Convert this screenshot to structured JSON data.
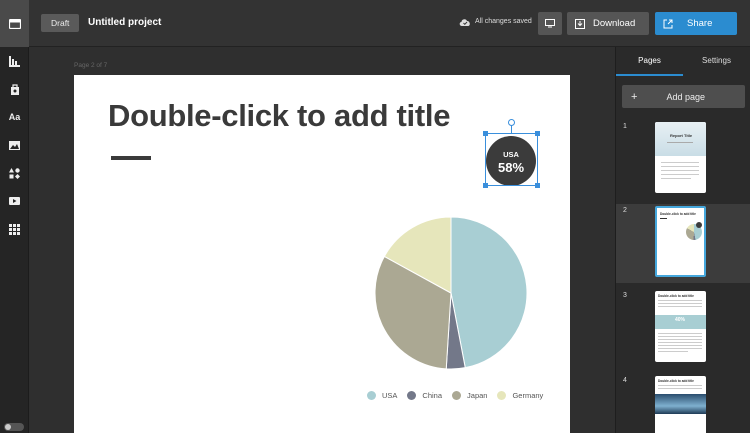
{
  "header": {
    "status_badge": "Draft",
    "project_name": "Untitled project",
    "save_status": "All changes saved",
    "download_label": "Download",
    "share_label": "Share"
  },
  "left_rail": {
    "items": [
      "projects-icon",
      "charts-icon",
      "elements-icon",
      "text-icon",
      "image-icon",
      "shapes-icon",
      "video-icon",
      "apps-icon"
    ]
  },
  "canvas": {
    "page_indicator": "Page 2 of 7",
    "title": "Double-click to add title",
    "badge": {
      "label": "USA",
      "value": "58%"
    }
  },
  "chart_data": {
    "type": "pie",
    "categories": [
      "USA",
      "China",
      "Japan",
      "Germany"
    ],
    "values": [
      47,
      4,
      32,
      17
    ],
    "colors": [
      "#a8ced3",
      "#737889",
      "#aba893",
      "#e6e6bb"
    ],
    "legend_position": "bottom-right"
  },
  "panel": {
    "tabs": [
      "Pages",
      "Settings"
    ],
    "active_tab": "Pages",
    "add_page_label": "Add page",
    "pages": [
      {
        "number": "1",
        "title": "Report Title"
      },
      {
        "number": "2",
        "title": "Double-click to add title"
      },
      {
        "number": "3",
        "title": "Double-click to add title",
        "stat": "40%"
      },
      {
        "number": "4",
        "title": "Double-click to add title"
      }
    ],
    "active_page": "2"
  },
  "colors": {
    "accent": "#2b8cd0",
    "selection": "#3a8fdc",
    "background": "#2e2e2e"
  }
}
